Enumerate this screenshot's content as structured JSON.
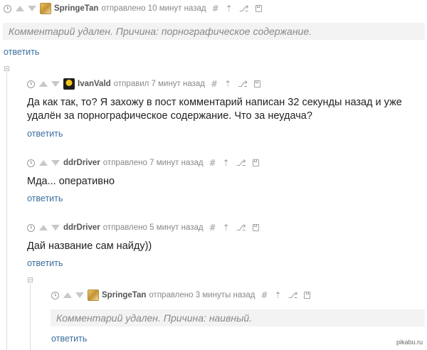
{
  "comments": [
    {
      "author": "SpringeTan",
      "meta": "отправлено 10 минут назад",
      "deleted_text": "Комментарий удален. Причина: порнографическое содержание.",
      "reply": "ответить"
    },
    {
      "author": "IvanVald",
      "meta": "отправил 7 минут назад",
      "line1": "Да как так, то? Я захожу в пост комментарий написан 32 секунды назад и уже",
      "line2": "удалён за порнографическое содержание. Что за неудача?",
      "reply": "ответить"
    },
    {
      "author": "ddrDriver",
      "meta": "отправлено 7 минут назад",
      "text": "Мда... оперативно",
      "reply": "ответить"
    },
    {
      "author": "ddrDriver",
      "meta": "отправлено 5 минут назад",
      "text": "Дай название сам найду))",
      "reply": "ответить"
    },
    {
      "author": "SpringeTan",
      "meta": "отправлено 3 минуты назад",
      "deleted_text": "Комментарий удален. Причина: наивный.",
      "reply": "ответить"
    }
  ],
  "icons": {
    "hash": "#",
    "up_arrow": "⇡",
    "branch": "⎇"
  },
  "watermark": "pikabu.ru"
}
